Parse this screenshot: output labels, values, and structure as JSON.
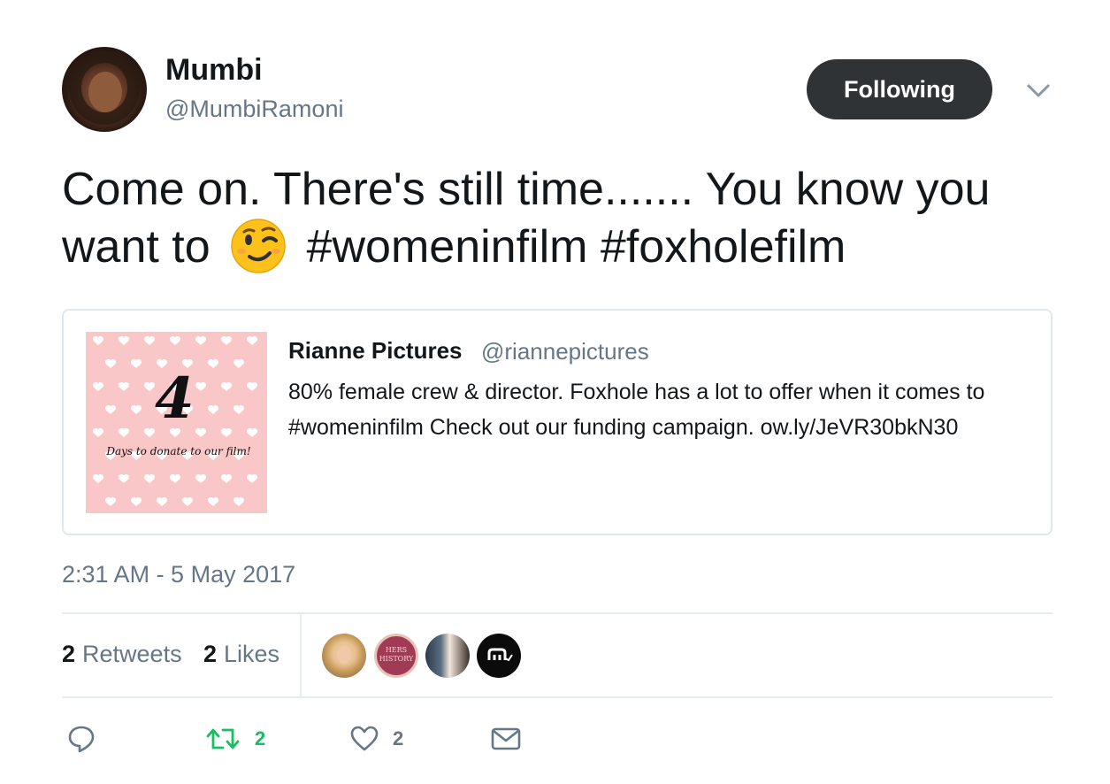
{
  "author": {
    "display_name": "Mumbi",
    "handle": "@MumbiRamoni",
    "avatar_icon": "profile-photo"
  },
  "follow_button": {
    "label": "Following"
  },
  "menu": {
    "icon": "chevron-down-icon"
  },
  "tweet": {
    "text_before_emoji": "Come on. There's still time....... You know you want to",
    "emoji": "winking-face",
    "text_after_emoji": "#womeninfilm #foxholefilm"
  },
  "quoted_tweet": {
    "display_name": "Rianne Pictures",
    "handle": "@riannepictures",
    "text": "80% female crew & director. Foxhole has a lot to offer when it comes to #womeninfilm Check out our funding campaign. ow.ly/JeVR30bkN30",
    "image": {
      "number": "4",
      "caption": "Days to donate to our film!",
      "background": "#f9c7c7"
    }
  },
  "timestamp": "2:31 AM - 5 May 2017",
  "stats": {
    "retweets_count": "2",
    "retweets_label": "Retweets",
    "likes_count": "2",
    "likes_label": "Likes"
  },
  "likers": [
    {
      "name": "liker-1",
      "icon": "avatar-blonde"
    },
    {
      "name": "liker-2",
      "icon": "avatar-hers-history",
      "text": "HERS HISTORY"
    },
    {
      "name": "liker-3",
      "icon": "avatar-photo"
    },
    {
      "name": "liker-4",
      "icon": "avatar-logo"
    }
  ],
  "actions": {
    "reply": {
      "icon": "reply-icon"
    },
    "retweet": {
      "icon": "retweet-icon",
      "count": "2",
      "color": "#17bf63"
    },
    "like": {
      "icon": "heart-icon",
      "count": "2"
    },
    "message": {
      "icon": "envelope-icon"
    }
  },
  "colors": {
    "text": "#14171a",
    "secondary": "#657786",
    "button_bg": "#303335",
    "border": "#e1e8ed",
    "retweet_green": "#17bf63"
  }
}
